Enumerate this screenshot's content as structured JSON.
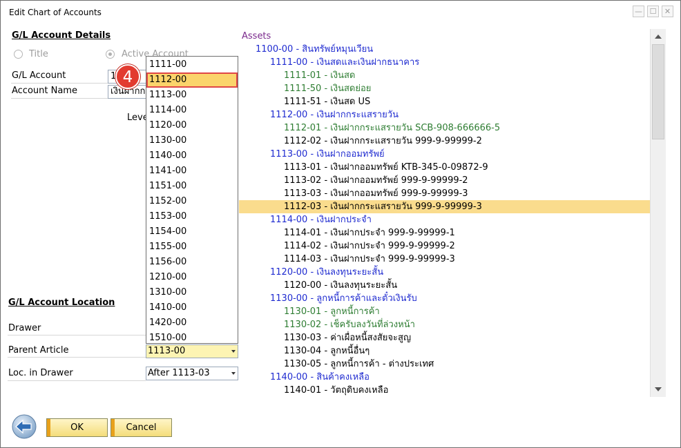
{
  "window": {
    "title": "Edit Chart of Accounts",
    "controls": {
      "minimize": "—",
      "maximize": "☐",
      "close": "✕"
    }
  },
  "left": {
    "details_heading": "G/L Account Details",
    "radio_title": "Title",
    "radio_active": "Active Account",
    "gl_account_label": "G/L Account",
    "gl_account_value": "1",
    "account_name_label": "Account Name",
    "account_name_value": "เงินฝากก",
    "level_label": "Leve",
    "location_heading": "G/L Account Location",
    "drawer_label": "Drawer",
    "parent_article_label": "Parent Article",
    "parent_article_value": "1113-00",
    "loc_in_drawer_label": "Loc. in Drawer",
    "loc_in_drawer_value": "After 1113-03"
  },
  "dropdown": {
    "options": [
      "1111-00",
      "1112-00",
      "1113-00",
      "1114-00",
      "1120-00",
      "1130-00",
      "1140-00",
      "1141-00",
      "1151-00",
      "1152-00",
      "1153-00",
      "1154-00",
      "1155-00",
      "1156-00",
      "1210-00",
      "1310-00",
      "1410-00",
      "1420-00",
      "1510-00"
    ],
    "selected_index": 1,
    "step_badge": "4"
  },
  "tree": {
    "rows": [
      {
        "text": "Assets",
        "level": 0,
        "color": "#7a2a8c"
      },
      {
        "text": "1100-00 - สินทรัพย์หมุนเวียน",
        "level": 1,
        "color": "#1f2bd0"
      },
      {
        "text": "1111-00 - เงินสดและเงินฝากธนาคาร",
        "level": 2,
        "color": "#1f2bd0"
      },
      {
        "text": "1111-01 - เงินสด",
        "level": 3,
        "color": "#2e7d32"
      },
      {
        "text": "1111-50 - เงินสดย่อย",
        "level": 3,
        "color": "#2e7d32"
      },
      {
        "text": "1111-51 - เงินสด US",
        "level": 3,
        "color": "#000000"
      },
      {
        "text": "1112-00 - เงินฝากกระแสรายวัน",
        "level": 2,
        "color": "#1f2bd0"
      },
      {
        "text": "1112-01 - เงินฝากกระแสรายวัน SCB-908-666666-5",
        "level": 3,
        "color": "#2e7d32"
      },
      {
        "text": "1112-02 - เงินฝากกระแสรายวัน 999-9-99999-2",
        "level": 3,
        "color": "#000000"
      },
      {
        "text": "1113-00 - เงินฝากออมทรัพย์",
        "level": 2,
        "color": "#1f2bd0"
      },
      {
        "text": "1113-01 - เงินฝากออมทรัพย์ KTB-345-0-09872-9",
        "level": 3,
        "color": "#000000"
      },
      {
        "text": "1113-02 - เงินฝากออมทรัพย์ 999-9-99999-2",
        "level": 3,
        "color": "#000000"
      },
      {
        "text": "1113-03 - เงินฝากออมทรัพย์ 999-9-99999-3",
        "level": 3,
        "color": "#000000"
      },
      {
        "text": "1112-03 - เงินฝากกระแสรายวัน 999-9-99999-3",
        "level": 3,
        "color": "#000000",
        "highlight": true
      },
      {
        "text": "1114-00 - เงินฝากประจำ",
        "level": 2,
        "color": "#1f2bd0"
      },
      {
        "text": "1114-01 - เงินฝากประจำ 999-9-99999-1",
        "level": 3,
        "color": "#000000"
      },
      {
        "text": "1114-02 - เงินฝากประจำ 999-9-99999-2",
        "level": 3,
        "color": "#000000"
      },
      {
        "text": "1114-03 - เงินฝากประจำ 999-9-99999-3",
        "level": 3,
        "color": "#000000"
      },
      {
        "text": "1120-00 - เงินลงทุนระยะสั้น",
        "level": 2,
        "color": "#1f2bd0"
      },
      {
        "text": "1120-00 - เงินลงทุนระยะสั้น",
        "level": 3,
        "color": "#000000"
      },
      {
        "text": "1130-00 - ลูกหนี้การค้าและตั๋วเงินรับ",
        "level": 2,
        "color": "#1f2bd0"
      },
      {
        "text": "1130-01 - ลูกหนี้การค้า",
        "level": 3,
        "color": "#2e7d32"
      },
      {
        "text": "1130-02 - เช็ครับลงวันที่ล่วงหน้า",
        "level": 3,
        "color": "#2e7d32"
      },
      {
        "text": "1130-03 - ค่าเผื่อหนี้สงสัยจะสูญ",
        "level": 3,
        "color": "#000000"
      },
      {
        "text": "1130-04 - ลูกหนี้อื่นๆ",
        "level": 3,
        "color": "#000000"
      },
      {
        "text": "1130-05 - ลูกหนี้การค้า - ต่างประเทศ",
        "level": 3,
        "color": "#000000"
      },
      {
        "text": "1140-00 - สินค้าคงเหลือ",
        "level": 2,
        "color": "#1f2bd0"
      },
      {
        "text": "1140-01 - วัตถุดิบคงเหลือ",
        "level": 3,
        "color": "#000000"
      }
    ]
  },
  "footer": {
    "ok_label": "OK",
    "cancel_label": "Cancel"
  },
  "colors": {
    "highlight": "#fadc8d",
    "selected_option": "#fbd46b",
    "badge": "#e23b30",
    "button_accent": "#e8a11b"
  }
}
